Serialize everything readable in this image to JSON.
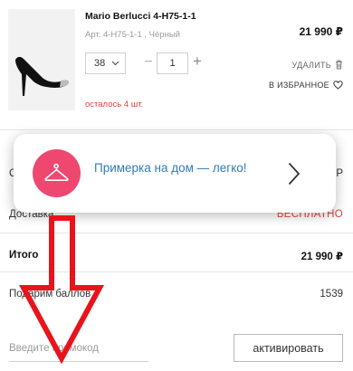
{
  "product": {
    "title": "Mario Berlucci 4-H75-1-1",
    "sku": "Арт. 4-H75-1-1 , Чёрный",
    "price": "21 990 ₽",
    "size": "38",
    "quantity": "1",
    "minus_label": "−",
    "plus_label": "+",
    "remove_label": "УДАЛИТЬ",
    "favorite_label": "В ИЗБРАННОЕ",
    "stock_note": "осталось 4 шт."
  },
  "summary": {
    "goods_value": "Р",
    "delivery_label": "Доставка",
    "delivery_value": "БЕСПЛАТНО",
    "total_label": "Итого",
    "total_value": "21 990 ₽",
    "bonus_label": "Подарим баллов",
    "bonus_value": "1539"
  },
  "promo": {
    "placeholder": "Введите промокод",
    "activate_label": "активировать"
  },
  "popup": {
    "text": "Примерка на дом — легко!",
    "icon": "hanger-icon"
  },
  "colors": {
    "accent_red": "#e5433f",
    "popup_circle": "#ee4770",
    "popup_text": "#2f7cb9",
    "arrow": "#e8141c"
  }
}
